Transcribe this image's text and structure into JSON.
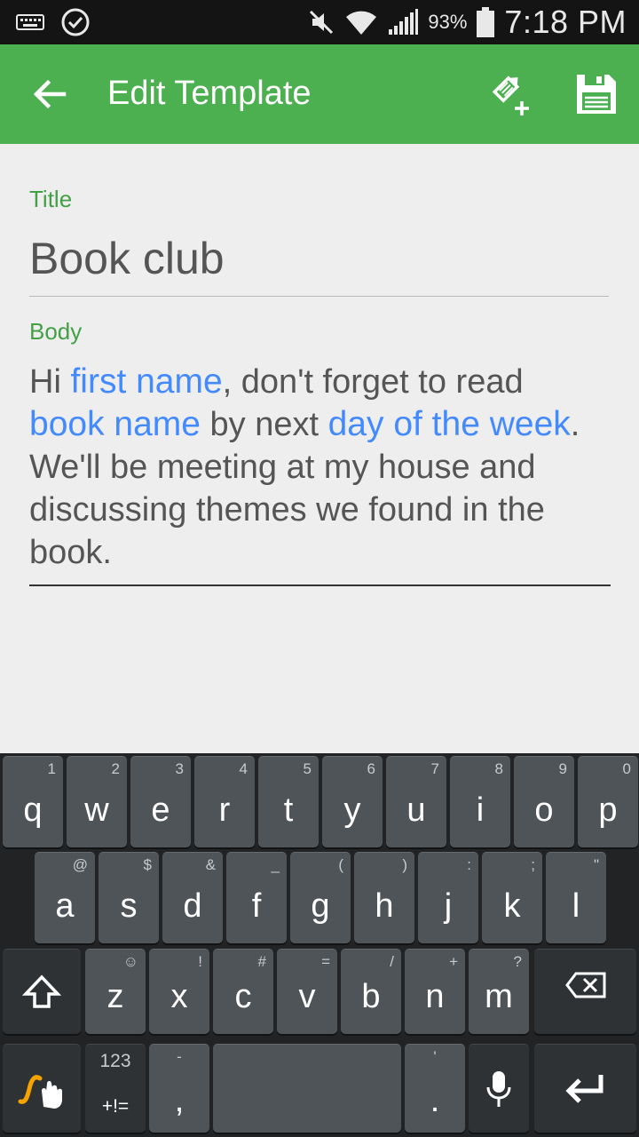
{
  "status_bar": {
    "battery_percent": "93%",
    "time": "7:18 PM"
  },
  "app_bar": {
    "title": "Edit Template"
  },
  "form": {
    "title_label": "Title",
    "title_value": "Book club",
    "body_label": "Body",
    "body": {
      "t1": "Hi ",
      "chip1": "first name",
      "t2": ", don't forget to read",
      "chip2": "book name",
      "t3": " by next ",
      "chip3": "day of the week",
      "t4": ".",
      "t5": "We'll be meeting at my house and discussing themes we found in the book."
    }
  },
  "keyboard": {
    "row1": [
      {
        "k": "q",
        "s": "1"
      },
      {
        "k": "w",
        "s": "2"
      },
      {
        "k": "e",
        "s": "3"
      },
      {
        "k": "r",
        "s": "4"
      },
      {
        "k": "t",
        "s": "5"
      },
      {
        "k": "y",
        "s": "6"
      },
      {
        "k": "u",
        "s": "7"
      },
      {
        "k": "i",
        "s": "8"
      },
      {
        "k": "o",
        "s": "9"
      },
      {
        "k": "p",
        "s": "0"
      }
    ],
    "row2": [
      {
        "k": "a",
        "s": "@"
      },
      {
        "k": "s",
        "s": "$"
      },
      {
        "k": "d",
        "s": "&"
      },
      {
        "k": "f",
        "s": "_"
      },
      {
        "k": "g",
        "s": "("
      },
      {
        "k": "h",
        "s": ")"
      },
      {
        "k": "j",
        "s": ":"
      },
      {
        "k": "k",
        "s": ";"
      },
      {
        "k": "l",
        "s": "\""
      }
    ],
    "row3": [
      {
        "k": "z",
        "s": "☺"
      },
      {
        "k": "x",
        "s": "!"
      },
      {
        "k": "c",
        "s": "#"
      },
      {
        "k": "v",
        "s": "="
      },
      {
        "k": "b",
        "s": "/"
      },
      {
        "k": "n",
        "s": "+"
      },
      {
        "k": "m",
        "s": "?"
      }
    ],
    "symbols_key_top": "123",
    "symbols_key_bottom": "+!=",
    "comma_key": ",",
    "comma_key_sub": "-",
    "period_key": ".",
    "period_key_sub": "'",
    "accent_color": "#f5a300"
  },
  "colors": {
    "app_bar": "#4caf50",
    "field_label": "#43a047",
    "chip": "#448aff"
  },
  "icons": {
    "back": "arrow-left",
    "add_field": "pencil-plus",
    "save": "floppy-disk"
  }
}
